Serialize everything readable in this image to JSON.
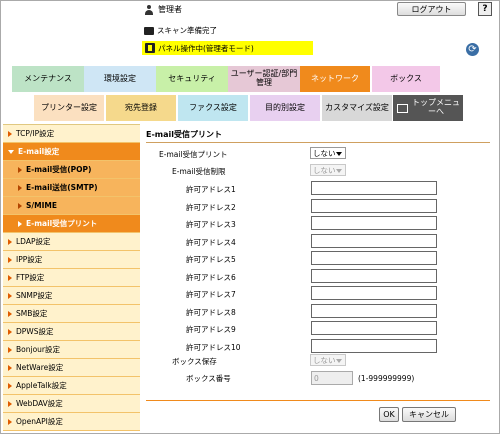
{
  "header": {
    "user": "管理者",
    "logout_label": "ログアウト",
    "help_label": "?",
    "status_scan": "スキャン準備完了",
    "status_panel": "パネル操作中(管理者モード)"
  },
  "tabs_main": [
    {
      "label": "メンテナンス",
      "color": "#bde3c6"
    },
    {
      "label": "環境設定",
      "color": "#cfe6f5"
    },
    {
      "label": "セキュリティ",
      "color": "#c8f0a8"
    },
    {
      "label": "ユーザー認証/部門管理",
      "color": "#e6c8d6"
    },
    {
      "label": "ネットワーク",
      "color": "#f08a1c"
    },
    {
      "label": "ボックス",
      "color": "#f3c8e8"
    }
  ],
  "tabs_sub": [
    {
      "label": "プリンター設定",
      "color": "#fbe0c0"
    },
    {
      "label": "宛先登録",
      "color": "#f5d98c"
    },
    {
      "label": "ファクス設定",
      "color": "#bfe6f0"
    },
    {
      "label": "目的別設定",
      "color": "#e8d0f0"
    },
    {
      "label": "カスタマイズ設定",
      "color": "#d8d8d8"
    },
    {
      "label": "トップメニューへ",
      "color": "#555555"
    }
  ],
  "sidebar": {
    "items": [
      {
        "label": "TCP/IP設定",
        "kind": "top"
      },
      {
        "label": "E-mail設定",
        "kind": "top-active"
      },
      {
        "label": "E-mail受信(POP)",
        "kind": "sub"
      },
      {
        "label": "E-mail送信(SMTP)",
        "kind": "sub"
      },
      {
        "label": "S/MIME",
        "kind": "sub"
      },
      {
        "label": "E-mail受信プリント",
        "kind": "sub-selected"
      },
      {
        "label": "LDAP設定",
        "kind": "top"
      },
      {
        "label": "IPP設定",
        "kind": "top"
      },
      {
        "label": "FTP設定",
        "kind": "top"
      },
      {
        "label": "SNMP設定",
        "kind": "top"
      },
      {
        "label": "SMB設定",
        "kind": "top"
      },
      {
        "label": "DPWS設定",
        "kind": "top"
      },
      {
        "label": "Bonjour設定",
        "kind": "top"
      },
      {
        "label": "NetWare設定",
        "kind": "top"
      },
      {
        "label": "AppleTalk設定",
        "kind": "top"
      },
      {
        "label": "WebDAV設定",
        "kind": "top"
      },
      {
        "label": "OpenAPI設定",
        "kind": "top"
      }
    ]
  },
  "main": {
    "title": "E-mail受信プリント",
    "print_label": "E-mail受信プリント",
    "print_value": "しない",
    "restrict_label": "E-mail受信制限",
    "restrict_value": "しない",
    "addresses": [
      {
        "label": "許可アドレス1",
        "value": ""
      },
      {
        "label": "許可アドレス2",
        "value": ""
      },
      {
        "label": "許可アドレス3",
        "value": ""
      },
      {
        "label": "許可アドレス4",
        "value": ""
      },
      {
        "label": "許可アドレス5",
        "value": ""
      },
      {
        "label": "許可アドレス6",
        "value": ""
      },
      {
        "label": "許可アドレス7",
        "value": ""
      },
      {
        "label": "許可アドレス8",
        "value": ""
      },
      {
        "label": "許可アドレス9",
        "value": ""
      },
      {
        "label": "許可アドレス10",
        "value": ""
      }
    ],
    "box_save_label": "ボックス保存",
    "box_save_value": "しない",
    "box_number_label": "ボックス番号",
    "box_number_value": "0",
    "box_number_range": "(1-999999999)",
    "ok_label": "OK",
    "cancel_label": "キャンセル"
  }
}
